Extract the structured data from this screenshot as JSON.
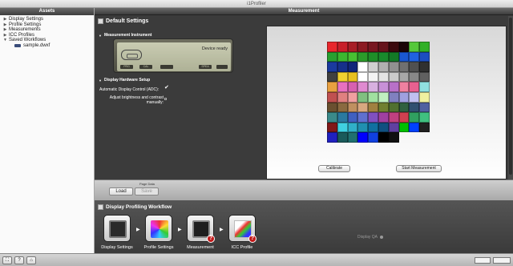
{
  "window": {
    "title": "i1Profiler"
  },
  "assets": {
    "header": "Assets",
    "items": [
      {
        "label": "Display Settings",
        "expanded": false
      },
      {
        "label": "Profile Settings",
        "expanded": false
      },
      {
        "label": "Measurements",
        "expanded": false
      },
      {
        "label": "ICC Profiles",
        "expanded": false
      },
      {
        "label": "Saved Workflows",
        "expanded": true
      }
    ],
    "files": [
      {
        "label": "sample.dwxf"
      }
    ]
  },
  "main": {
    "header": "Measurement",
    "settings_title": "Default Settings",
    "instrument": {
      "section_title": "Measurement Instrument",
      "status": "Device ready",
      "buttons": [
        "PRG",
        "CAL",
        "",
        "SPEA",
        ""
      ]
    },
    "hardware": {
      "section_title": "Display Hardware Setup",
      "adc_label": "Automatic Display Control (ADC):",
      "adc_checked": true,
      "brightness_label": "Adjust brightness and contrast manually:"
    },
    "buttons": {
      "calibrate": "Calibrate",
      "start": "Start Measurement"
    },
    "patches": [
      [
        "#e8262c",
        "#c8202a",
        "#a81e26",
        "#8c1a22",
        "#781720",
        "#66141c",
        "#3c0a0e",
        "#1a0407",
        "#55c83a",
        "#30b026"
      ],
      [
        "#28a030",
        "#3cb830",
        "#48c032",
        "#2c9c2a",
        "#1e8e28",
        "#198a2c",
        "#137a26",
        "#1a58d0",
        "#2062e0",
        "#1c4ec0"
      ],
      [
        "#1a3a9e",
        "#16308a",
        "#12267a",
        "#ffffff",
        "#d0d0d0",
        "#b0b0b0",
        "#909090",
        "#707070",
        "#505050",
        "#303030"
      ],
      [
        "#404040",
        "#f0d030",
        "#e8c020",
        "#ffffff",
        "#f4f4f4",
        "#e4e4e4",
        "#cacaca",
        "#a8a8a8",
        "#888888",
        "#606060"
      ],
      [
        "#e8a040",
        "#e870c0",
        "#d860b0",
        "#e08ad0",
        "#d8b0e0",
        "#c890d8",
        "#b870c8",
        "#f080a0",
        "#e86090",
        "#90e0e0"
      ],
      [
        "#c05050",
        "#e08080",
        "#f0a0a0",
        "#80c080",
        "#a0e0a0",
        "#c0f0c0",
        "#8080c0",
        "#a0a0e0",
        "#c0c0f0",
        "#f0f0a0"
      ],
      [
        "#6a5030",
        "#8a6a40",
        "#c09060",
        "#d8a880",
        "#a08040",
        "#708030",
        "#507030",
        "#306040",
        "#305070",
        "#5060a0"
      ],
      [
        "#3a8a8a",
        "#2a7aa0",
        "#4060c0",
        "#6070d0",
        "#8050c0",
        "#a040a0",
        "#c04080",
        "#d04050",
        "#30a060",
        "#40c080"
      ],
      [
        "#801818",
        "#40d0e0",
        "#30b0c8",
        "#2090b0",
        "#1070a0",
        "#105080",
        "#6040a0",
        "#00c000",
        "#0040ff",
        "#202020"
      ],
      [
        "#2020c0",
        "#1a5a5a",
        "#207070",
        "#0000ff",
        "#1040e0",
        "#000000",
        "#101010"
      ]
    ],
    "page_data": {
      "label": "Page Data",
      "load": "Load",
      "save": "Save"
    }
  },
  "workflow": {
    "title": "Display Profiling Workflow",
    "steps": [
      {
        "label": "Display Settings",
        "icon": "display-settings-icon",
        "error": false
      },
      {
        "label": "Profile Settings",
        "icon": "profile-settings-icon",
        "error": false
      },
      {
        "label": "Measurement",
        "icon": "measurement-icon",
        "error": true
      },
      {
        "label": "ICC Profile",
        "icon": "icc-profile-icon",
        "error": true
      }
    ],
    "qa_label": "Display QA"
  },
  "statusbar": {
    "buttons": [
      "⛶",
      "?",
      "⌂"
    ],
    "logos": [
      "",
      ""
    ]
  }
}
